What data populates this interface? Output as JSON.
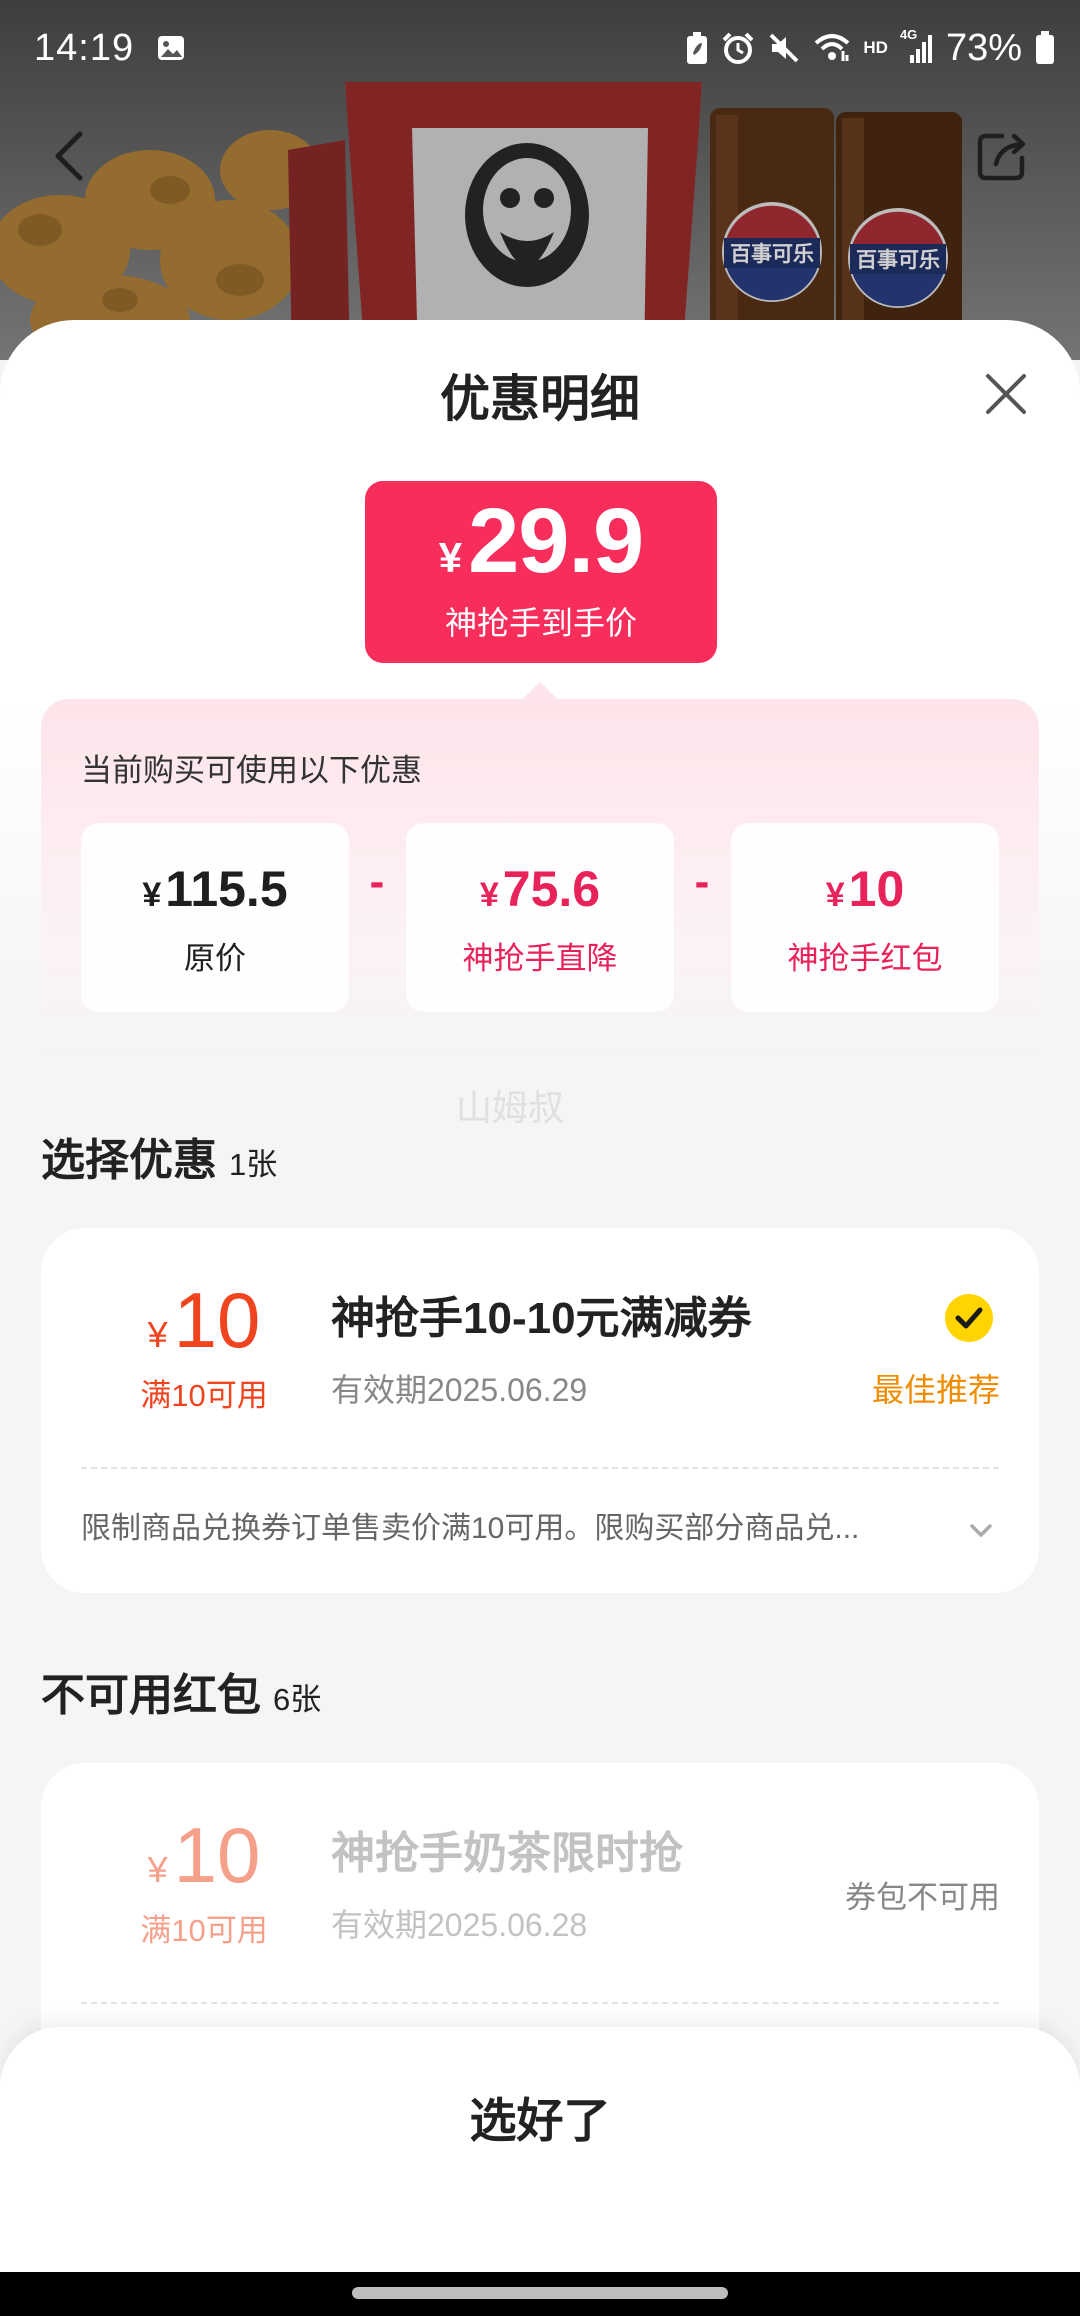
{
  "status_bar": {
    "time": "14:19",
    "hd_label": "HD",
    "network_label": "4G",
    "battery_percent": "73%"
  },
  "header": {
    "cup_logo_text": "百事可乐"
  },
  "sheet": {
    "title": "优惠明细"
  },
  "price_badge": {
    "currency": "¥",
    "amount": "29.9",
    "label": "神抢手到手价"
  },
  "discount_panel": {
    "heading": "当前购买可使用以下优惠",
    "operator": "-",
    "items": [
      {
        "currency": "¥",
        "amount": "115.5",
        "label": "原价"
      },
      {
        "currency": "¥",
        "amount": "75.6",
        "label": "神抢手直降"
      },
      {
        "currency": "¥",
        "amount": "10",
        "label": "神抢手红包"
      }
    ]
  },
  "watermark": "山姆叔",
  "available_section": {
    "title": "选择优惠",
    "count": "1张",
    "coupons": [
      {
        "currency": "¥",
        "amount": "10",
        "threshold": "满10可用",
        "name": "神抢手10-10元满减券",
        "validity": "有效期2025.06.29",
        "tag": "最佳推荐",
        "selected": true,
        "description": "限制商品兑换券订单售卖价满10可用。限购买部分商品兑..."
      }
    ]
  },
  "unavailable_section": {
    "title": "不可用红包",
    "count": "6张",
    "coupons": [
      {
        "currency": "¥",
        "amount": "10",
        "threshold": "满10可用",
        "name": "神抢手奶茶限时抢",
        "validity": "有效期2025.06.28",
        "status": "券包不可用"
      }
    ]
  },
  "footer": {
    "confirm_label": "选好了"
  },
  "icons": {
    "back": "back-arrow-icon",
    "share": "share-icon",
    "close": "close-icon",
    "selected": "check-circle-icon",
    "expand": "chevron-down-icon"
  },
  "colors": {
    "brand_pink": "#f72d5c",
    "discount_pink": "#e8235a",
    "coupon_orange": "#f0441f",
    "recommend_orange": "#f08c00",
    "check_yellow": "#ffd400"
  }
}
